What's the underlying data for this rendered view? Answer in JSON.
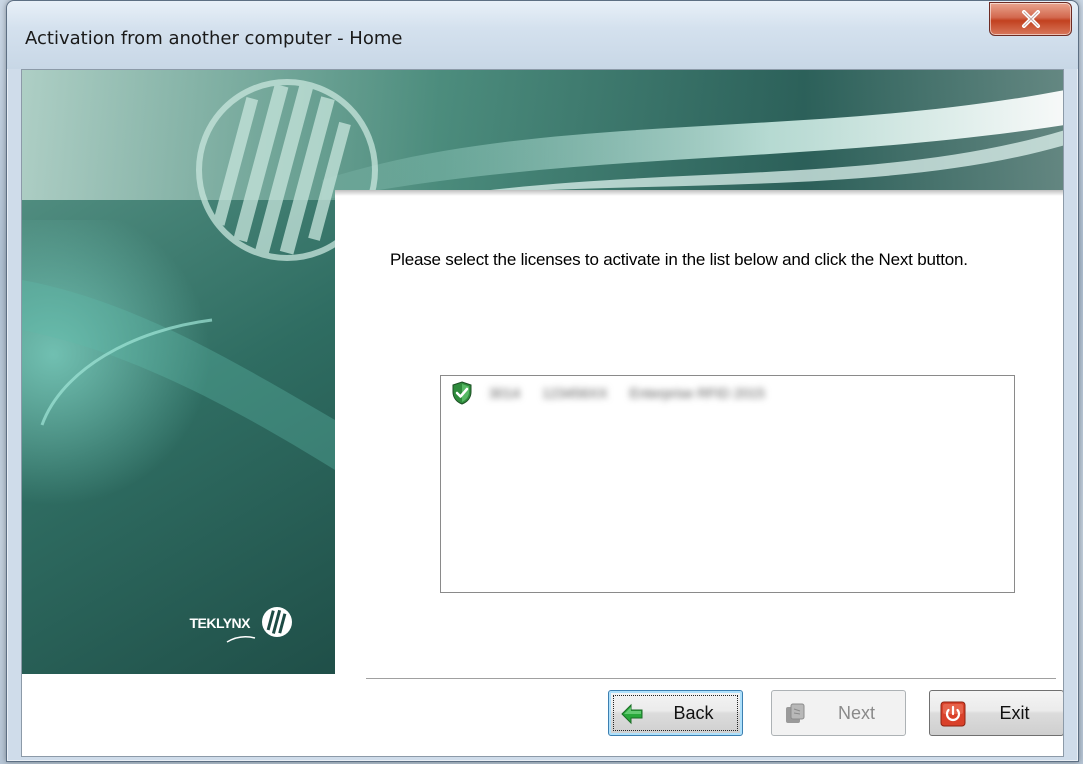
{
  "window": {
    "title": "Activation from another computer - Home"
  },
  "banner": {
    "brand": "TEKLYNX"
  },
  "main": {
    "instruction": "Please select the licenses to activate in the list below and click the Next button.",
    "licenses": [
      {
        "icon": "shield-check-icon",
        "id": "3014",
        "key": "123456XX",
        "name": "Enterprise RFID 2015"
      }
    ]
  },
  "buttons": {
    "back": "Back",
    "next": "Next",
    "exit": "Exit"
  },
  "colors": {
    "banner_teal": "#3f8f7e",
    "banner_dark": "#1b3b3a",
    "close_red": "#c2411f",
    "focus_blue": "#3c7fb1"
  }
}
